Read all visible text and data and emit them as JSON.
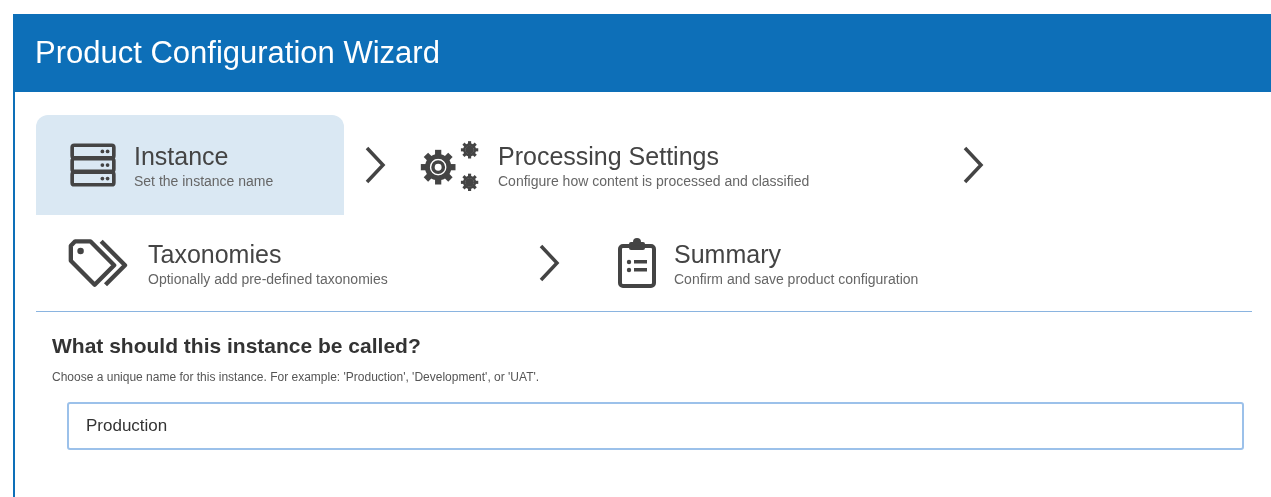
{
  "window": {
    "title": "Product Configuration Wizard"
  },
  "step_rows": [
    [
      {
        "kind": "server",
        "title": "Instance",
        "subtitle": "Set the instance name",
        "selected": true
      },
      {
        "kind": "gears",
        "title": "Processing Settings",
        "subtitle": "Configure how content is processed and classified",
        "selected": false
      }
    ],
    [
      {
        "kind": "tags",
        "title": "Taxonomies",
        "subtitle": "Optionally add pre-defined taxonomies",
        "selected": false
      },
      {
        "kind": "clipboard",
        "title": "Summary",
        "subtitle": "Confirm and save product configuration",
        "selected": false
      }
    ]
  ],
  "form": {
    "question": "What should this instance be called?",
    "help": "Choose a unique name for this instance. For example: 'Production', 'Development', or 'UAT'.",
    "value": "Production"
  }
}
